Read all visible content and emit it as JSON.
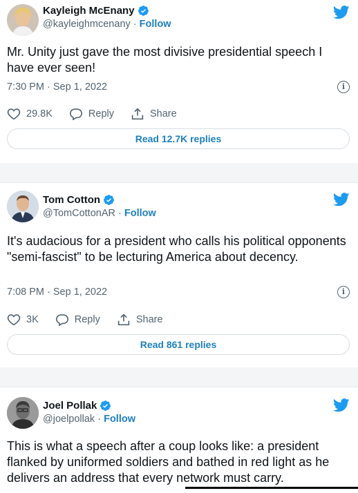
{
  "tweets": [
    {
      "name": "Kayleigh McEnany",
      "handle": "@kayleighmcenany",
      "separator": "·",
      "follow": "Follow",
      "text": "Mr. Unity just gave the most divisive presidential speech I have ever seen!",
      "time": "7:30 PM · Sep 1, 2022",
      "likes": "29.8K",
      "reply": "Reply",
      "share": "Share",
      "read_replies": "Read 12.7K replies"
    },
    {
      "name": "Tom Cotton",
      "handle": "@TomCottonAR",
      "separator": "·",
      "follow": "Follow",
      "text": "It's audacious for a president who calls his political opponents \"semi-fascist\" to be lecturing America about decency.",
      "time": "7:08 PM · Sep 1, 2022",
      "likes": "3K",
      "reply": "Reply",
      "share": "Share",
      "read_replies": "Read 861 replies"
    },
    {
      "name": "Joel Pollak",
      "handle": "@joelpollak",
      "separator": "·",
      "follow": "Follow",
      "text": "This is what a speech after a coup looks like: a president flanked by uniformed soldiers and bathed in red light as he delivers an address that every network must carry."
    }
  ],
  "icons": {
    "verified": "verified-badge-icon",
    "brand": "twitter-bird-icon",
    "info": "info-icon",
    "like": "heart-icon",
    "reply": "reply-bubble-icon",
    "share": "share-upload-icon"
  },
  "colors": {
    "accent": "#1d9bf0",
    "link": "#1d7fbf",
    "muted": "#536471",
    "text": "#0f1419"
  }
}
